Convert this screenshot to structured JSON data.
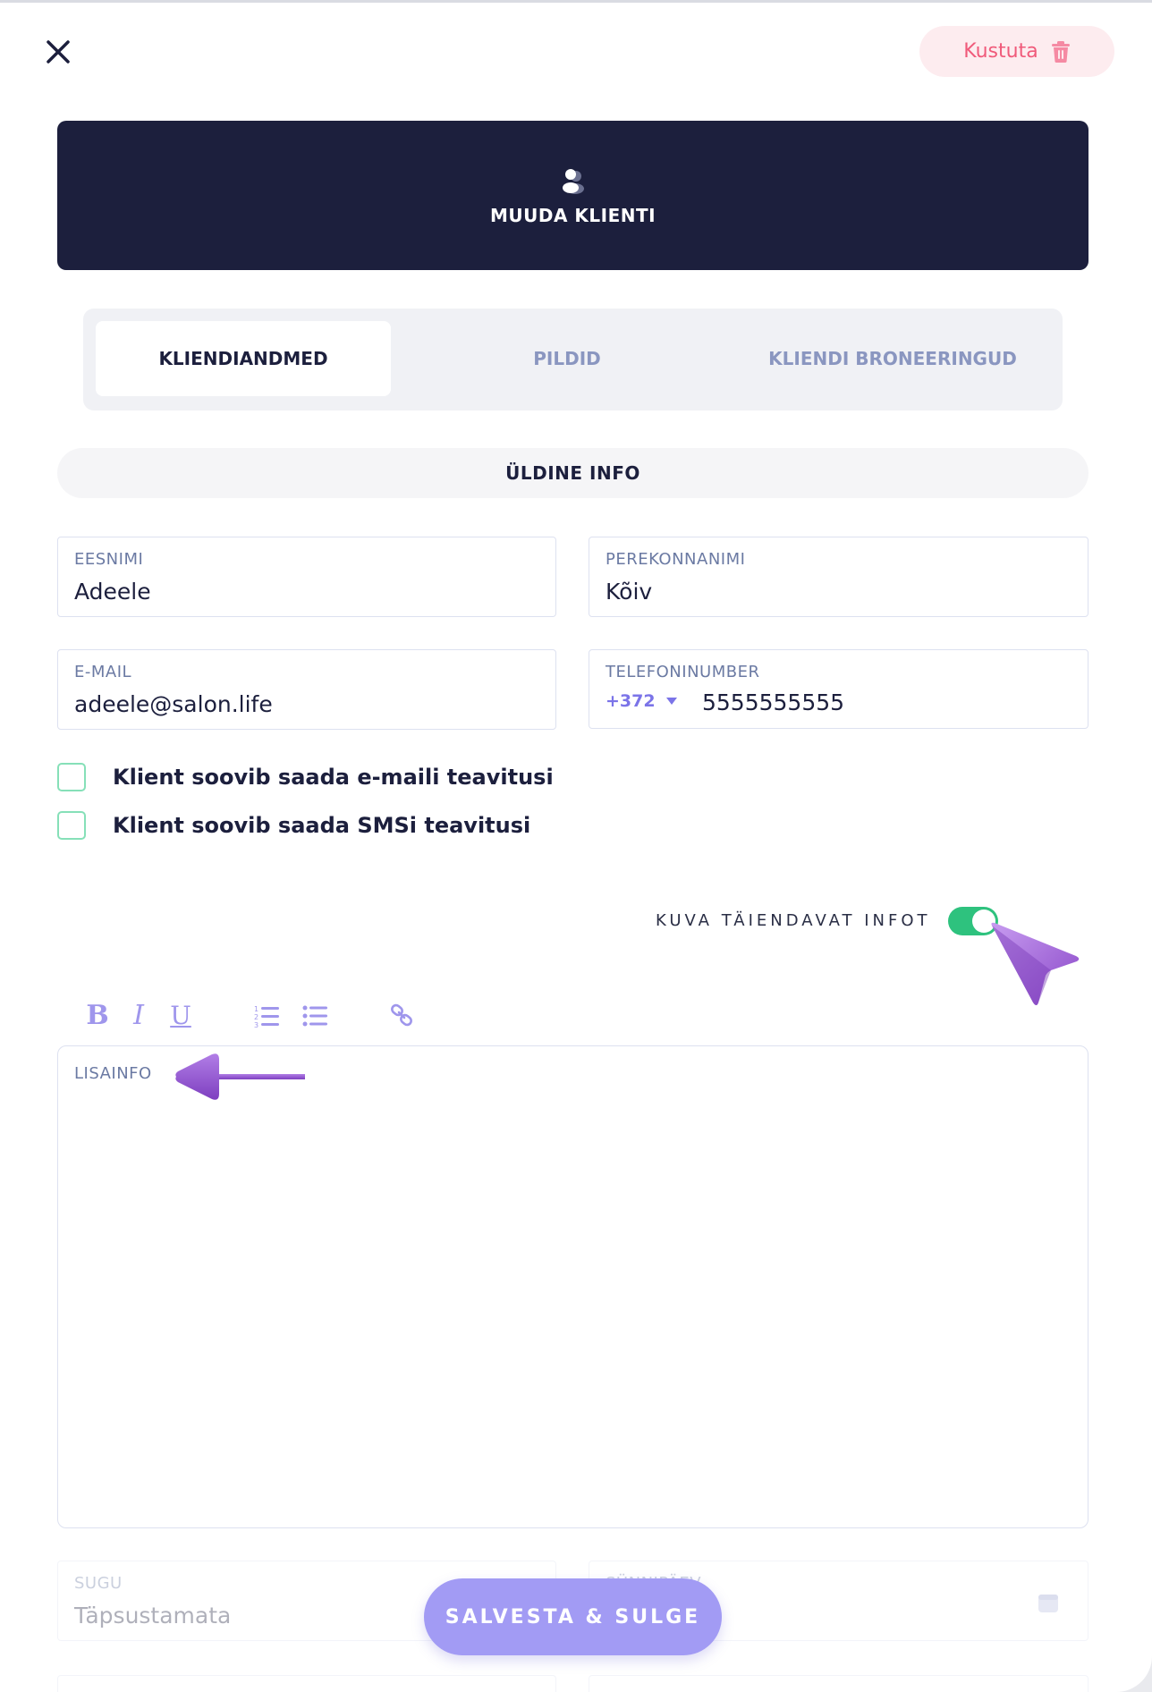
{
  "top": {
    "delete_label": "Kustuta"
  },
  "header": {
    "title": "MUUDA KLIENTI"
  },
  "tabs": [
    {
      "label": "KLIENDIANDMED",
      "active": true
    },
    {
      "label": "PILDID",
      "active": false
    },
    {
      "label": "KLIENDI BRONEERINGUD",
      "active": false
    }
  ],
  "section": {
    "title": "ÜLDINE INFO"
  },
  "fields": {
    "first_name": {
      "label": "EESNIMI",
      "value": "Adeele"
    },
    "last_name": {
      "label": "PEREKONNANIMI",
      "value": "Kõiv"
    },
    "email": {
      "label": "E-MAIL",
      "value": "adeele@salon.life"
    },
    "phone": {
      "label": "TELEFONINUMBER",
      "country_code": "+372",
      "value": "5555555555"
    }
  },
  "checkboxes": {
    "email_notify": {
      "label": "Klient soovib saada e-maili teavitusi",
      "checked": false
    },
    "sms_notify": {
      "label": "Klient soovib saada SMSi teavitusi",
      "checked": false
    }
  },
  "toggle": {
    "label": "KUVA TÄIENDAVAT INFOT",
    "on": true
  },
  "editor": {
    "toolbar": [
      "bold-icon",
      "italic-icon",
      "underline-icon",
      "ordered-list-icon",
      "bullet-list-icon",
      "link-icon"
    ],
    "bold": "B",
    "italic": "I",
    "underline": "U",
    "label": "LISAINFO"
  },
  "lower_fields": {
    "gender": {
      "label": "SUGU",
      "value": "Täpsustamata"
    },
    "birthday": {
      "label": "SÜNNIPÄEV"
    }
  },
  "save_label": "SALVESTA & SULGE",
  "colors": {
    "navy": "#1c1f3d",
    "accent": "#a29bf4",
    "delete": "#f05a7a",
    "toggle_on": "#2ec27e",
    "annotation": "#9b59d0"
  }
}
